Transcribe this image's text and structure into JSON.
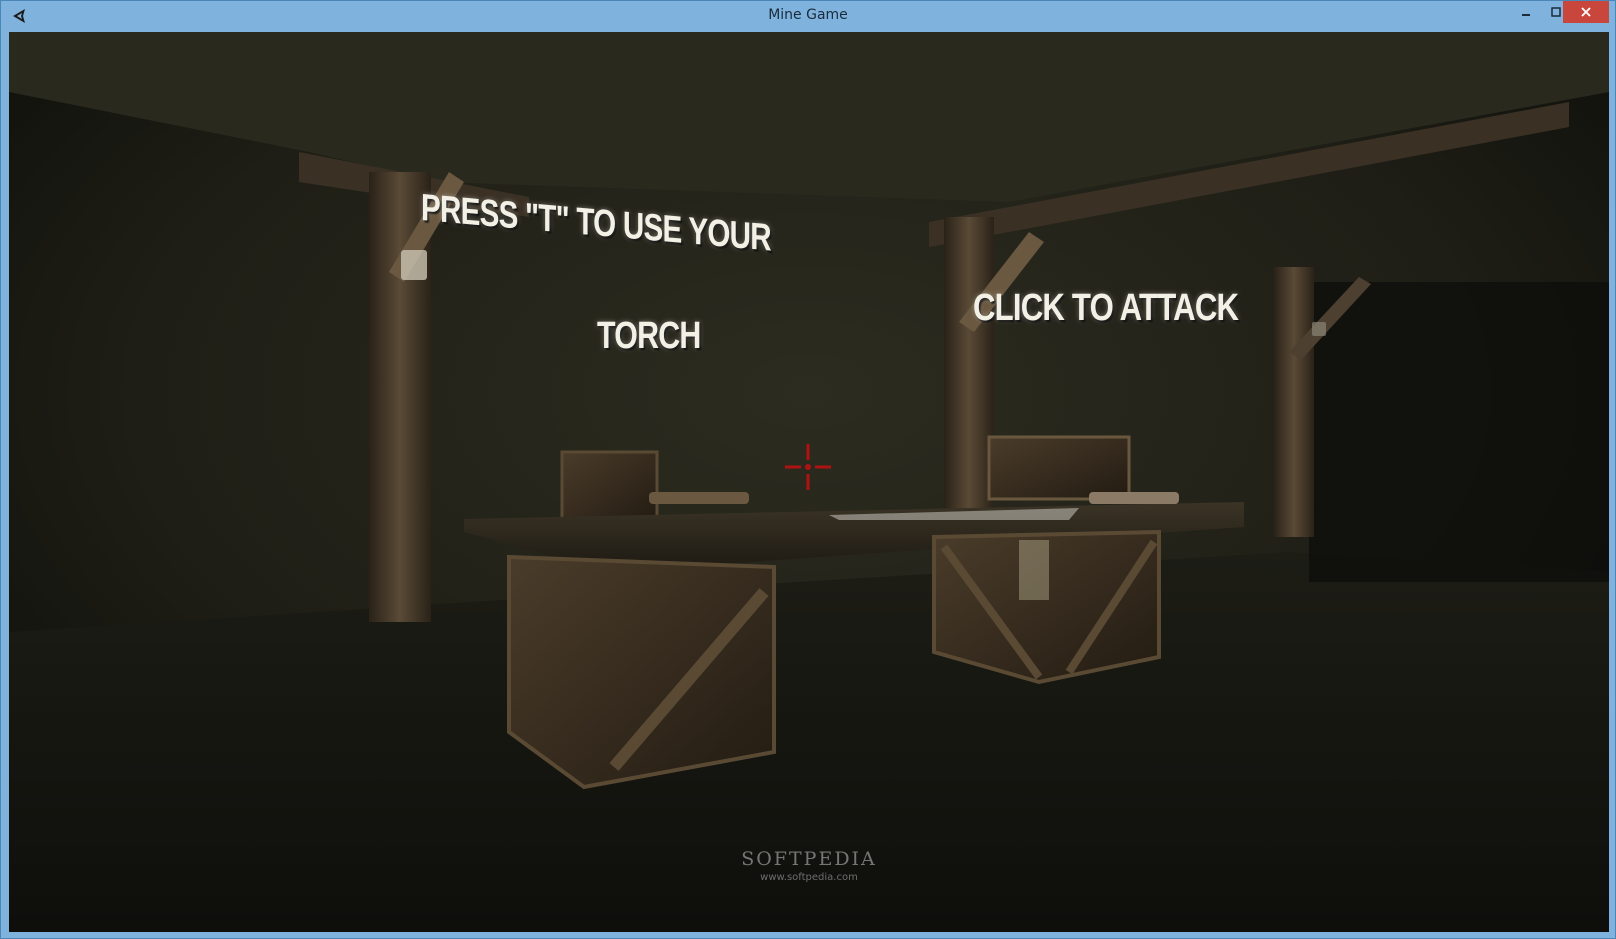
{
  "window": {
    "title": "Mine Game",
    "controls": {
      "minimize": "minimize-icon",
      "maximize": "maximize-icon",
      "close": "close-icon"
    },
    "accent": "#7fb3de",
    "close_color": "#c9463d"
  },
  "hud": {
    "torch_hint_line1": "PRESS \"T\" TO USE YOUR",
    "torch_hint_line2": "TORCH",
    "attack_hint": "CLICK TO ATTACK",
    "crosshair_color": "#b01212"
  },
  "watermark": {
    "logo": "SOFTPEDIA",
    "url": "www.softpedia.com"
  }
}
